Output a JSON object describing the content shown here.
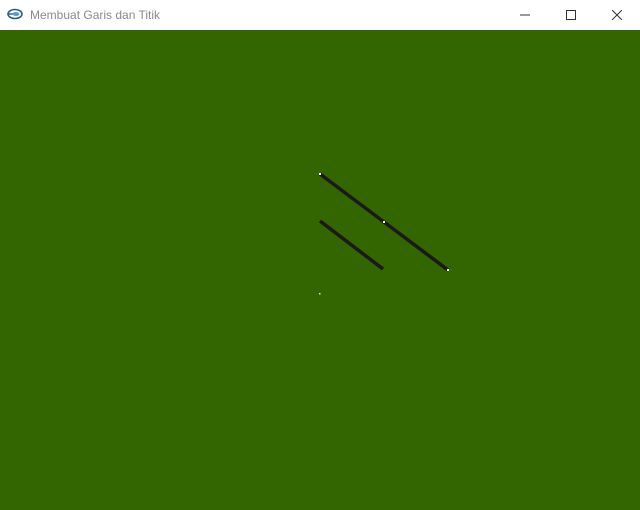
{
  "window": {
    "title": "Membuat Garis dan Titik",
    "app_icon": "opengl-app-icon",
    "controls": [
      "minimize-icon",
      "maximize-icon",
      "close-icon"
    ]
  },
  "canvas": {
    "background_color": "#336600",
    "line_color": "#1a1a1a",
    "point_color": "#ffffff"
  }
}
